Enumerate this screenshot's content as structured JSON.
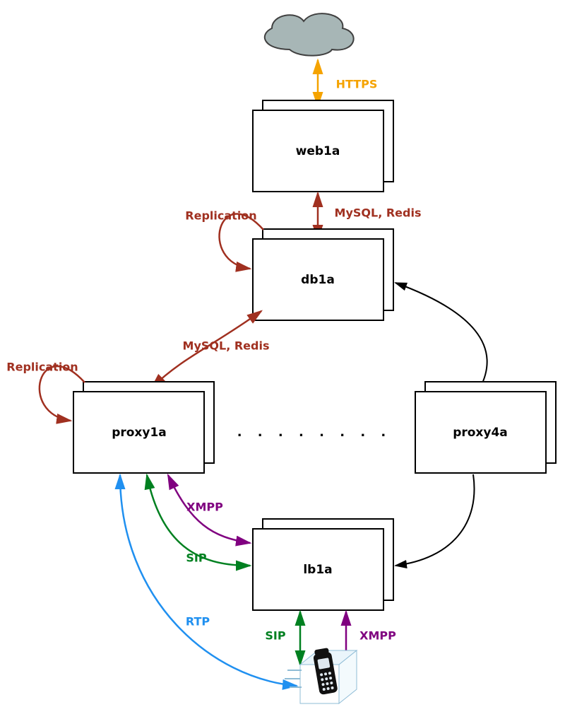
{
  "nodes": {
    "cloud": {
      "type": "cloud"
    },
    "web1a": {
      "label": "web1a"
    },
    "db1a": {
      "label": "db1a"
    },
    "proxy1a": {
      "label": "proxy1a"
    },
    "proxy4a": {
      "label": "proxy4a"
    },
    "lb1a": {
      "label": "lb1a"
    },
    "phone": {
      "type": "phone"
    }
  },
  "dots": ". . . . . . . .",
  "edges": {
    "https": {
      "label": "HTTPS",
      "color": "#f5a300"
    },
    "mysql_redis1": {
      "label": "MySQL, Redis",
      "color": "#a03020"
    },
    "replication1": {
      "label": "Replication",
      "color": "#a03020"
    },
    "mysql_redis2": {
      "label": "MySQL, Redis",
      "color": "#a03020"
    },
    "replication2": {
      "label": "Replication",
      "color": "#a03020"
    },
    "xmpp1": {
      "label": "XMPP",
      "color": "#800080"
    },
    "sip1": {
      "label": "SIP",
      "color": "#008020"
    },
    "rtp": {
      "label": "RTP",
      "color": "#2090f0"
    },
    "sip2": {
      "label": "SIP",
      "color": "#008020"
    },
    "xmpp2": {
      "label": "XMPP",
      "color": "#800080"
    },
    "db_proxy4": {
      "color": "#000000"
    },
    "proxy4_lb": {
      "color": "#000000"
    }
  }
}
